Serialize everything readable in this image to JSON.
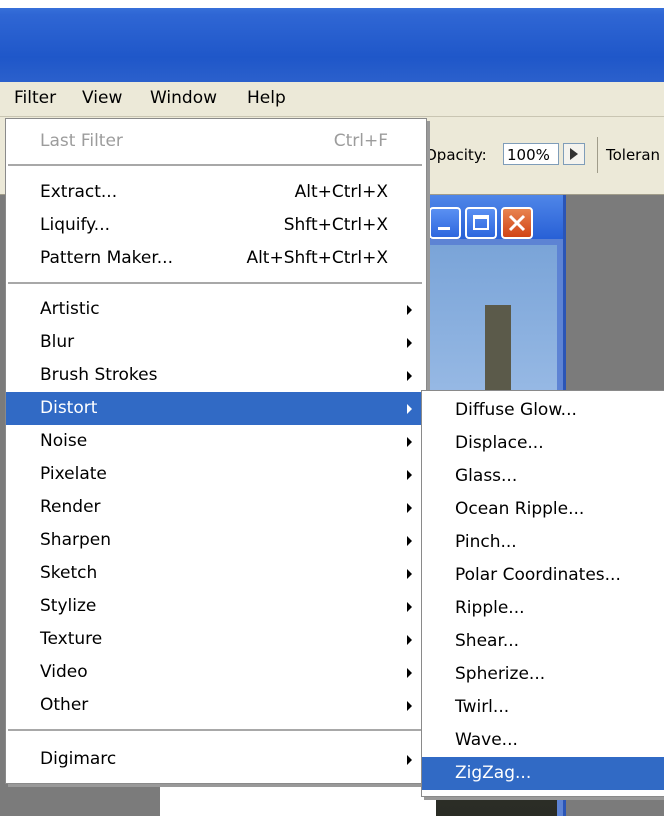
{
  "menubar": {
    "items": [
      {
        "label": "Filter"
      },
      {
        "label": "View"
      },
      {
        "label": "Window"
      },
      {
        "label": "Help"
      }
    ]
  },
  "options_bar": {
    "opacity_label": "Opacity:",
    "opacity_value": "100%",
    "tolerance_label": "Toleran"
  },
  "filter_menu": {
    "items": [
      {
        "label": "Last Filter",
        "shortcut": "Ctrl+F",
        "disabled": true
      },
      {
        "label": "Extract...",
        "shortcut": "Alt+Ctrl+X"
      },
      {
        "label": "Liquify...",
        "shortcut": "Shft+Ctrl+X"
      },
      {
        "label": "Pattern Maker...",
        "shortcut": "Alt+Shft+Ctrl+X"
      },
      {
        "label": "Artistic",
        "submenu": true
      },
      {
        "label": "Blur",
        "submenu": true
      },
      {
        "label": "Brush Strokes",
        "submenu": true
      },
      {
        "label": "Distort",
        "submenu": true,
        "selected": true
      },
      {
        "label": "Noise",
        "submenu": true
      },
      {
        "label": "Pixelate",
        "submenu": true
      },
      {
        "label": "Render",
        "submenu": true
      },
      {
        "label": "Sharpen",
        "submenu": true
      },
      {
        "label": "Sketch",
        "submenu": true
      },
      {
        "label": "Stylize",
        "submenu": true
      },
      {
        "label": "Texture",
        "submenu": true
      },
      {
        "label": "Video",
        "submenu": true
      },
      {
        "label": "Other",
        "submenu": true
      },
      {
        "label": "Digimarc",
        "submenu": true
      }
    ]
  },
  "distort_menu": {
    "items": [
      {
        "label": "Diffuse Glow..."
      },
      {
        "label": "Displace..."
      },
      {
        "label": "Glass..."
      },
      {
        "label": "Ocean Ripple..."
      },
      {
        "label": "Pinch..."
      },
      {
        "label": "Polar Coordinates..."
      },
      {
        "label": "Ripple..."
      },
      {
        "label": "Shear..."
      },
      {
        "label": "Spherize..."
      },
      {
        "label": "Twirl..."
      },
      {
        "label": "Wave..."
      },
      {
        "label": "ZigZag...",
        "selected": true
      }
    ]
  },
  "colors": {
    "selection": "#316ac5",
    "titlebar": "#2f66d4",
    "menubar": "#ece9d8",
    "close_button": "#d14416"
  }
}
